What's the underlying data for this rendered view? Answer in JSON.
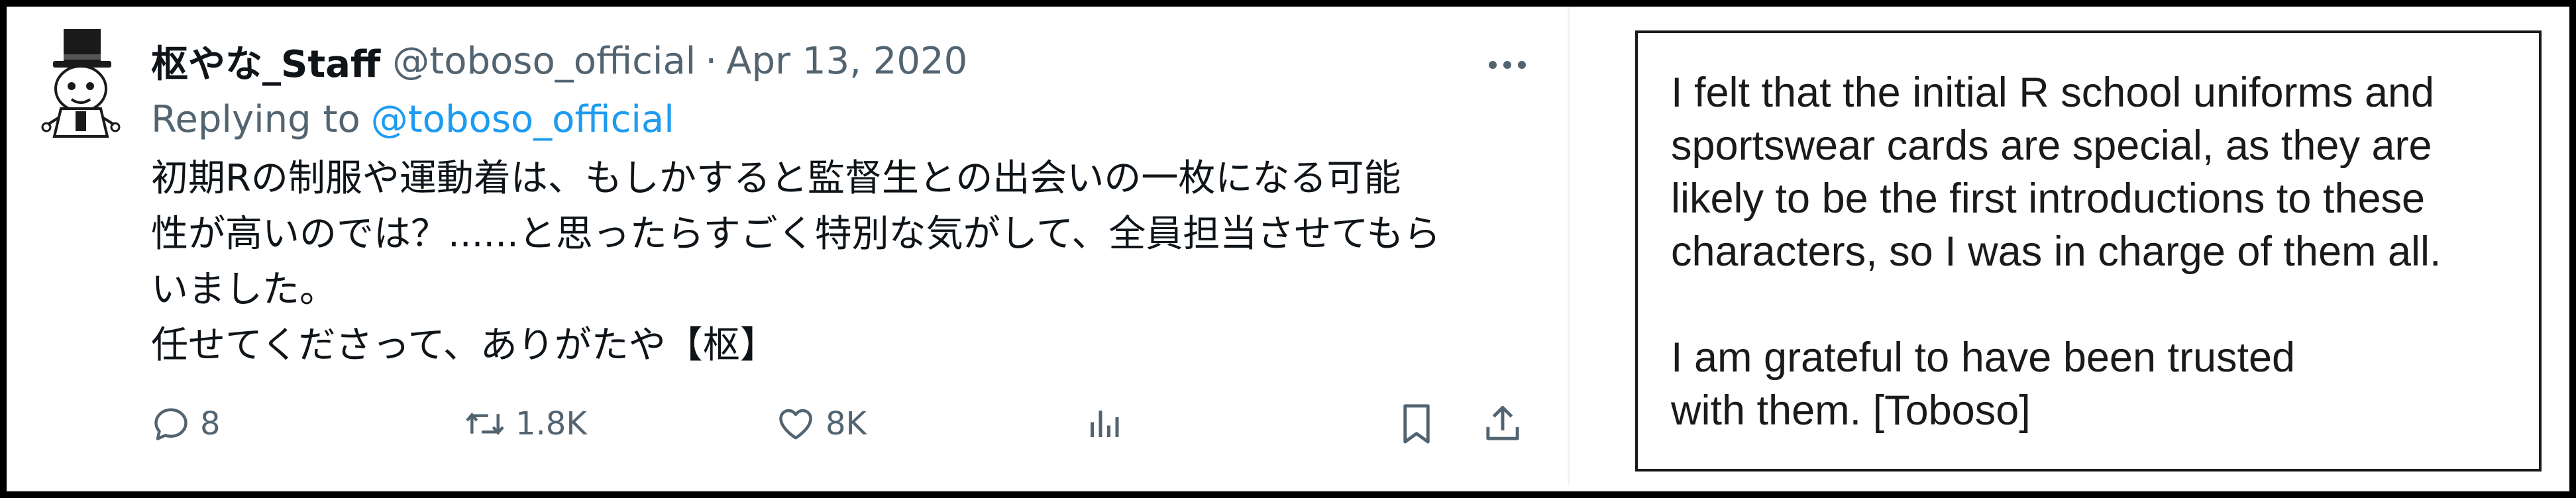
{
  "tweet": {
    "display_name": "枢やな_Staff",
    "handle": "@toboso_official",
    "separator": "·",
    "date": "Apr 13, 2020",
    "more_icon": "more-horizontal-icon",
    "replying_to_label": "Replying to",
    "replying_to_handle": "@toboso_official",
    "body_lines": [
      "初期Rの制服や運動着は、もしかすると監督生との出会いの一枚になる可能",
      "性が高いのでは？......と思ったらすごく特別な気がして、全員担当させてもら",
      "いました。",
      "任せてくださって、ありがたや【枢】"
    ],
    "actions": {
      "reply": {
        "icon": "reply-icon",
        "count": "8"
      },
      "retweet": {
        "icon": "retweet-icon",
        "count": "1.8K"
      },
      "like": {
        "icon": "heart-icon",
        "count": "8K"
      },
      "views": {
        "icon": "views-chart-icon"
      },
      "bookmark": {
        "icon": "bookmark-icon"
      },
      "share": {
        "icon": "share-icon"
      }
    }
  },
  "translation": {
    "paragraph_1": [
      "I felt that the initial R school uniforms and",
      "sportswear cards are special, as they are",
      "likely to be the first introductions to these",
      "characters, so I was in charge of them all."
    ],
    "paragraph_2": [
      "I am grateful to have been trusted",
      "with them. [Toboso]"
    ]
  },
  "colors": {
    "name": "#0f1419",
    "secondary": "#536471",
    "link": "#1d9bf0",
    "frame": "#000000"
  }
}
